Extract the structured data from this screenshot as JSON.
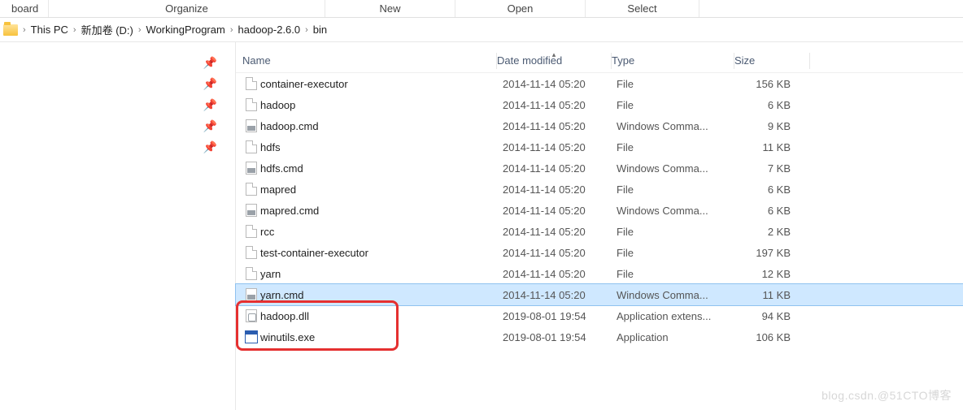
{
  "ribbon": {
    "tabs": [
      "board",
      "Organize",
      "New",
      "Open",
      "Select"
    ]
  },
  "breadcrumb": {
    "items": [
      "This PC",
      "新加卷 (D:)",
      "WorkingProgram",
      "hadoop-2.6.0",
      "bin"
    ]
  },
  "columns": {
    "name": "Name",
    "date": "Date modified",
    "type": "Type",
    "size": "Size"
  },
  "files": [
    {
      "icon": "file",
      "name": "container-executor",
      "date": "2014-11-14 05:20",
      "type": "File",
      "size": "156 KB",
      "sel": false
    },
    {
      "icon": "file",
      "name": "hadoop",
      "date": "2014-11-14 05:20",
      "type": "File",
      "size": "6 KB",
      "sel": false
    },
    {
      "icon": "cmd",
      "name": "hadoop.cmd",
      "date": "2014-11-14 05:20",
      "type": "Windows Comma...",
      "size": "9 KB",
      "sel": false
    },
    {
      "icon": "file",
      "name": "hdfs",
      "date": "2014-11-14 05:20",
      "type": "File",
      "size": "11 KB",
      "sel": false
    },
    {
      "icon": "cmd",
      "name": "hdfs.cmd",
      "date": "2014-11-14 05:20",
      "type": "Windows Comma...",
      "size": "7 KB",
      "sel": false
    },
    {
      "icon": "file",
      "name": "mapred",
      "date": "2014-11-14 05:20",
      "type": "File",
      "size": "6 KB",
      "sel": false
    },
    {
      "icon": "cmd",
      "name": "mapred.cmd",
      "date": "2014-11-14 05:20",
      "type": "Windows Comma...",
      "size": "6 KB",
      "sel": false
    },
    {
      "icon": "file",
      "name": "rcc",
      "date": "2014-11-14 05:20",
      "type": "File",
      "size": "2 KB",
      "sel": false
    },
    {
      "icon": "file",
      "name": "test-container-executor",
      "date": "2014-11-14 05:20",
      "type": "File",
      "size": "197 KB",
      "sel": false
    },
    {
      "icon": "file",
      "name": "yarn",
      "date": "2014-11-14 05:20",
      "type": "File",
      "size": "12 KB",
      "sel": false
    },
    {
      "icon": "cmd",
      "name": "yarn.cmd",
      "date": "2014-11-14 05:20",
      "type": "Windows Comma...",
      "size": "11 KB",
      "sel": true
    },
    {
      "icon": "dll",
      "name": "hadoop.dll",
      "date": "2019-08-01 19:54",
      "type": "Application extens...",
      "size": "94 KB",
      "sel": false
    },
    {
      "icon": "exe",
      "name": "winutils.exe",
      "date": "2019-08-01 19:54",
      "type": "Application",
      "size": "106 KB",
      "sel": false
    }
  ],
  "watermark": "blog.csdn.@51CTO博客"
}
